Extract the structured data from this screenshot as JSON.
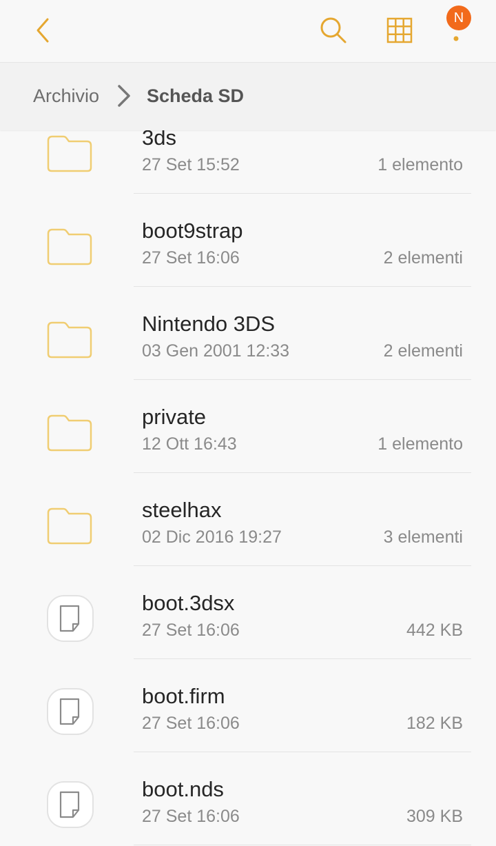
{
  "colors": {
    "accent": "#e5a730",
    "badge": "#f26a1b",
    "text_primary": "#262626",
    "text_secondary": "#8a8a8a"
  },
  "toolbar": {
    "back_icon": "chevron-left-icon",
    "search_icon": "search-icon",
    "grid_icon": "grid-view-icon",
    "more_icon": "more-vert-icon",
    "badge_text": "N"
  },
  "breadcrumb": {
    "root": "Archivio",
    "current": "Scheda SD"
  },
  "files": [
    {
      "type": "folder",
      "name": "3ds",
      "date": "27 Set 15:52",
      "meta": "1 elemento"
    },
    {
      "type": "folder",
      "name": "boot9strap",
      "date": "27 Set 16:06",
      "meta": "2 elementi"
    },
    {
      "type": "folder",
      "name": "Nintendo 3DS",
      "date": "03 Gen 2001 12:33",
      "meta": "2 elementi"
    },
    {
      "type": "folder",
      "name": "private",
      "date": "12 Ott 16:43",
      "meta": "1 elemento"
    },
    {
      "type": "folder",
      "name": "steelhax",
      "date": "02 Dic 2016 19:27",
      "meta": "3 elementi"
    },
    {
      "type": "file",
      "name": "boot.3dsx",
      "date": "27 Set 16:06",
      "meta": "442 KB"
    },
    {
      "type": "file",
      "name": "boot.firm",
      "date": "27 Set 16:06",
      "meta": "182 KB"
    },
    {
      "type": "file",
      "name": "boot.nds",
      "date": "27 Set 16:06",
      "meta": "309 KB"
    }
  ]
}
